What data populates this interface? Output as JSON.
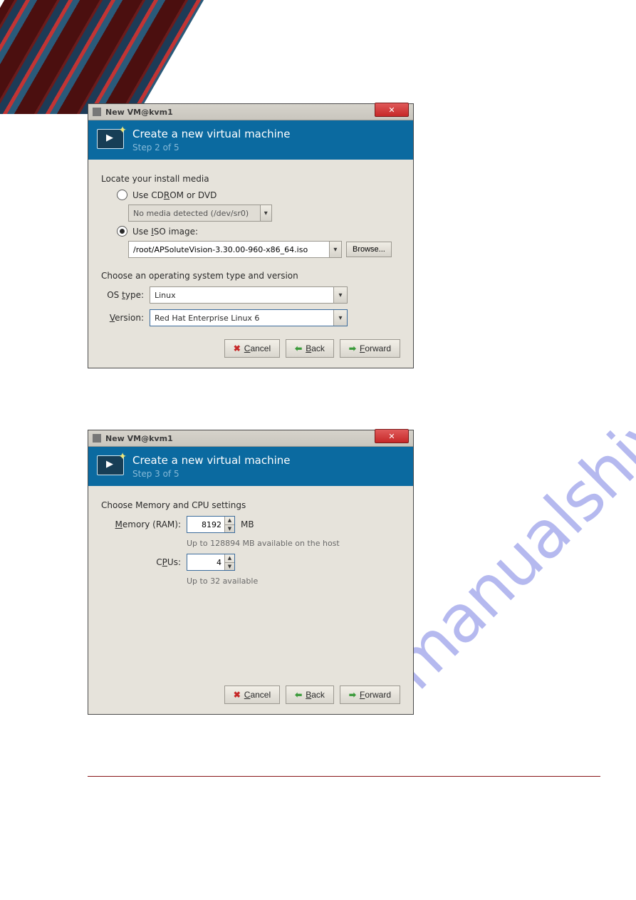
{
  "watermark": "manualshive.com",
  "dialog1": {
    "title": "New VM@kvm1",
    "banner_title": "Create a new virtual machine",
    "step": "Step 2 of 5",
    "locate_label": "Locate your install media",
    "radio_cdrom": "Use CDROM or DVD",
    "cdrom_placeholder": "No media detected (/dev/sr0)",
    "radio_iso": "Use ISO image:",
    "iso_value": "/root/APSoluteVision-3.30.00-960-x86_64.iso",
    "browse": "Browse...",
    "choose_os_label": "Choose an operating system type and version",
    "os_type_label": "OS type:",
    "os_type_value": "Linux",
    "version_label": "Version:",
    "version_value": "Red Hat Enterprise Linux 6",
    "cancel": "Cancel",
    "back": "Back",
    "forward": "Forward"
  },
  "dialog2": {
    "title": "New VM@kvm1",
    "banner_title": "Create a new virtual machine",
    "step": "Step 3 of 5",
    "choose_label": "Choose Memory and CPU settings",
    "memory_label": "Memory (RAM):",
    "memory_value": "8192",
    "memory_unit": "MB",
    "memory_hint": "Up to 128894 MB available on the host",
    "cpus_label": "CPUs:",
    "cpus_value": "4",
    "cpus_hint": "Up to 32 available",
    "cancel": "Cancel",
    "back": "Back",
    "forward": "Forward"
  }
}
